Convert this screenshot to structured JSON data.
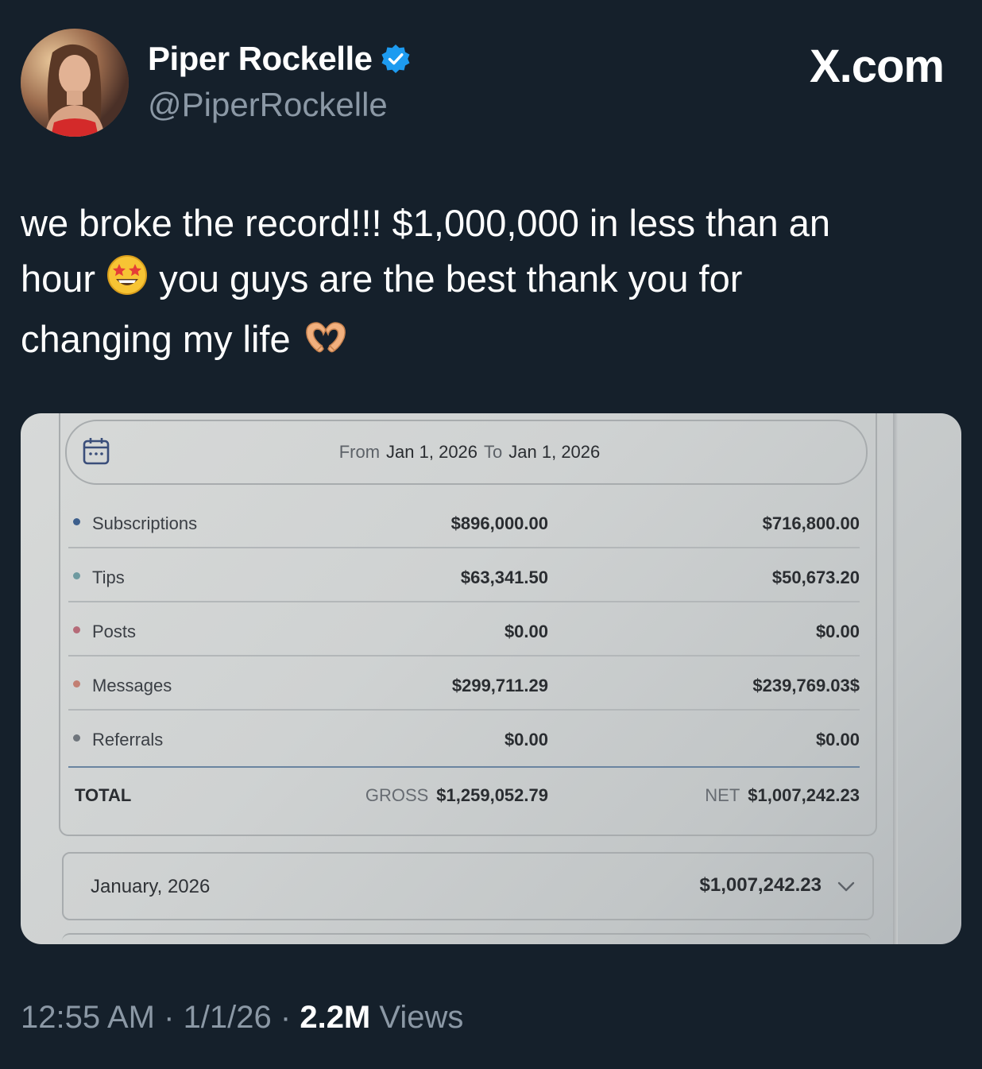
{
  "author": {
    "display_name": "Piper Rockelle",
    "handle": "@PiperRockelle",
    "verified_icon": "verified-badge-icon"
  },
  "watermark": "X.com",
  "tweet": {
    "line1": "we broke the record!!! $1,000,000 in less than an",
    "line2_a": "hour",
    "line2_b": "you guys are the best thank you for",
    "line3": "changing my life",
    "emoji_1": "star-struck-emoji",
    "emoji_2": "heart-hands-emoji"
  },
  "earnings": {
    "date_range": {
      "from_label": "From",
      "from_date": "Jan 1, 2026",
      "to_label": "To",
      "to_date": "Jan 1, 2026"
    },
    "rows": [
      {
        "label": "Subscriptions",
        "gross": "$896,000.00",
        "net": "$716,800.00",
        "dot_color": "#3d5f8c"
      },
      {
        "label": "Tips",
        "gross": "$63,341.50",
        "net": "$50,673.20",
        "dot_color": "#6e9aa0"
      },
      {
        "label": "Posts",
        "gross": "$0.00",
        "net": "$0.00",
        "dot_color": "#b56b78"
      },
      {
        "label": "Messages",
        "gross": "$299,711.29",
        "net": "$239,769.03$",
        "dot_color": "#c27f73"
      },
      {
        "label": "Referrals",
        "gross": "$0.00",
        "net": "$0.00",
        "dot_color": "#6f757c"
      }
    ],
    "total": {
      "label": "TOTAL",
      "gross_tag": "GROSS",
      "gross": "$1,259,052.79",
      "net_tag": "NET",
      "net": "$1,007,242.23"
    },
    "month": {
      "label": "January, 2026",
      "amount": "$1,007,242.23"
    }
  },
  "meta": {
    "time": "12:55 AM",
    "sep1": " · ",
    "date": "1/1/26",
    "sep2": " · ",
    "views_count": "2.2M",
    "views_label": " Views"
  }
}
